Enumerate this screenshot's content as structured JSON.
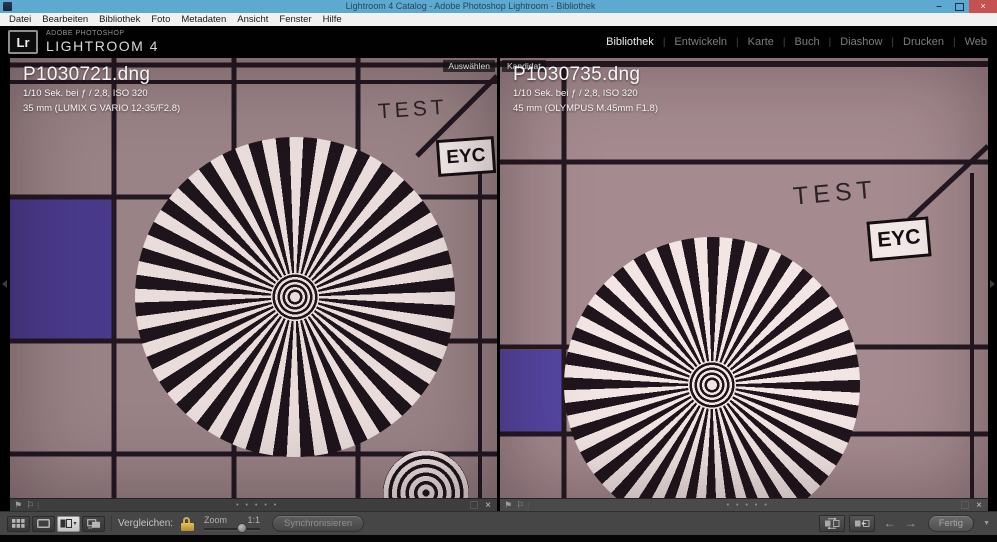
{
  "window": {
    "title": "Lightroom 4 Catalog - Adobe Photoshop Lightroom - Bibliothek",
    "minimize": "–",
    "close": "×"
  },
  "menubar": {
    "items": [
      "Datei",
      "Bearbeiten",
      "Bibliothek",
      "Foto",
      "Metadaten",
      "Ansicht",
      "Fenster",
      "Hilfe"
    ]
  },
  "header": {
    "logo": "Lr",
    "brand_top": "ADOBE PHOTOSHOP",
    "brand_bottom": "LIGHTROOM 4",
    "separator": "|",
    "modules": [
      {
        "label": "Bibliothek",
        "active": true
      },
      {
        "label": "Entwickeln",
        "active": false
      },
      {
        "label": "Karte",
        "active": false
      },
      {
        "label": "Buch",
        "active": false
      },
      {
        "label": "Diashow",
        "active": false
      },
      {
        "label": "Drucken",
        "active": false
      },
      {
        "label": "Web",
        "active": false
      }
    ]
  },
  "compare": {
    "select": {
      "badge": "Auswählen",
      "filename": "P1030721.dng",
      "exposure": "1/10 Sek. bei ƒ / 2,8, ISO 320",
      "lens": "35 mm (LUMIX G VARIO 12-35/F2.8)",
      "chart": {
        "test": "TEST",
        "eyc": "EYC"
      }
    },
    "candidate": {
      "badge": "Kandidat",
      "filename": "P1030735.dng",
      "exposure": "1/10 Sek. bei ƒ / 2,8, ISO 320",
      "lens": "45 mm (OLYMPUS M.45mm F1.8)",
      "chart": {
        "test": "TEST",
        "eyc": "EYC"
      }
    },
    "strip": {
      "flag_pick": "⚑",
      "flag_reject": "⚐",
      "rating_dots": "•••••",
      "deselect": "×"
    }
  },
  "toolbar": {
    "compare_label": "Vergleichen:",
    "zoom_label": "Zoom",
    "zoom_ratio": "1:1",
    "sync": "Synchronisieren",
    "done": "Fertig",
    "prev": "←",
    "next": "→",
    "menu_chevron": "▼"
  },
  "colors": {
    "titlebar_blue": "#5ea9cf",
    "close_red": "#c75050",
    "lock_gold": "#d4b04a",
    "photo_bg_select": "#9a8386",
    "photo_bg_candidate": "#a58b8f",
    "chart_purple_select": "#4a3a8c",
    "chart_purple_candidate": "#5546a2"
  }
}
